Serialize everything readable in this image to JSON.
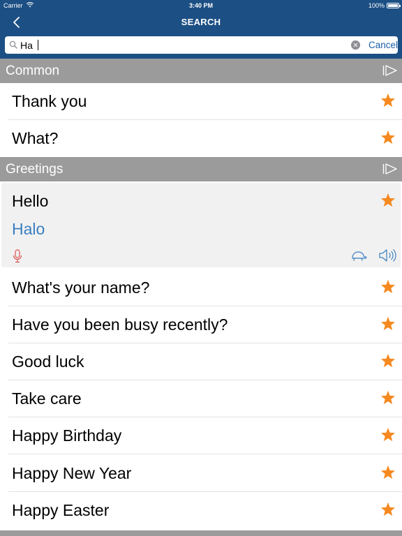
{
  "status_bar": {
    "carrier": "Carrier",
    "time": "3:40 PM",
    "battery": "100%"
  },
  "nav": {
    "title": "SEARCH"
  },
  "search": {
    "value": "Ha",
    "placeholder": "",
    "cancel_label": "Cancel"
  },
  "sections": [
    {
      "title": "Common"
    },
    {
      "title": "Greetings"
    }
  ],
  "common_items": [
    {
      "label": "Thank you"
    },
    {
      "label": "What?"
    }
  ],
  "expanded_item": {
    "label": "Hello",
    "translation": "Halo"
  },
  "greeting_items": [
    {
      "label": "What's your name?"
    },
    {
      "label": "Have you been busy recently?"
    },
    {
      "label": "Good luck"
    },
    {
      "label": "Take care"
    },
    {
      "label": "Happy Birthday"
    },
    {
      "label": "Happy New Year"
    },
    {
      "label": "Happy Easter"
    }
  ],
  "icons": {
    "back": "chevron-left-icon",
    "search": "search-icon",
    "clear": "clear-icon",
    "play": "play-all-icon",
    "star": "star-icon",
    "mic": "microphone-icon",
    "slow": "turtle-icon",
    "speaker": "speaker-icon"
  },
  "colors": {
    "nav_bar": "#1c4f84",
    "section_header": "#9b9b9b",
    "star": "#f5891f",
    "translation": "#3a7fc1",
    "mic": "#d9534f",
    "link": "#1a5fa6"
  }
}
